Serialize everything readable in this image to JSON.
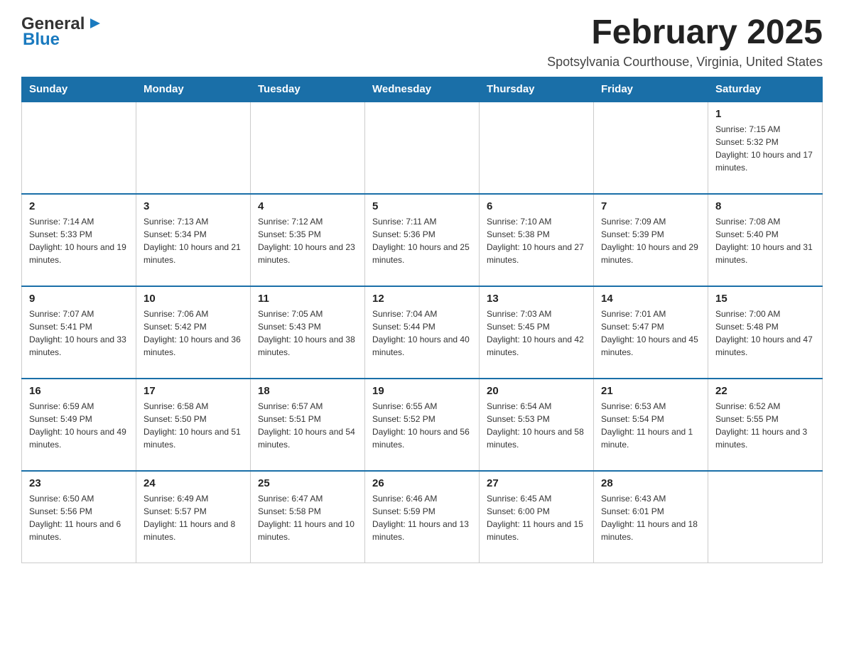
{
  "header": {
    "logo": {
      "general": "General",
      "blue": "Blue",
      "arrow_color": "#1a7abf"
    },
    "title": "February 2025",
    "location": "Spotsylvania Courthouse, Virginia, United States"
  },
  "days_of_week": [
    "Sunday",
    "Monday",
    "Tuesday",
    "Wednesday",
    "Thursday",
    "Friday",
    "Saturday"
  ],
  "weeks": [
    {
      "days": [
        {
          "number": "",
          "info": ""
        },
        {
          "number": "",
          "info": ""
        },
        {
          "number": "",
          "info": ""
        },
        {
          "number": "",
          "info": ""
        },
        {
          "number": "",
          "info": ""
        },
        {
          "number": "",
          "info": ""
        },
        {
          "number": "1",
          "info": "Sunrise: 7:15 AM\nSunset: 5:32 PM\nDaylight: 10 hours and 17 minutes."
        }
      ]
    },
    {
      "days": [
        {
          "number": "2",
          "info": "Sunrise: 7:14 AM\nSunset: 5:33 PM\nDaylight: 10 hours and 19 minutes."
        },
        {
          "number": "3",
          "info": "Sunrise: 7:13 AM\nSunset: 5:34 PM\nDaylight: 10 hours and 21 minutes."
        },
        {
          "number": "4",
          "info": "Sunrise: 7:12 AM\nSunset: 5:35 PM\nDaylight: 10 hours and 23 minutes."
        },
        {
          "number": "5",
          "info": "Sunrise: 7:11 AM\nSunset: 5:36 PM\nDaylight: 10 hours and 25 minutes."
        },
        {
          "number": "6",
          "info": "Sunrise: 7:10 AM\nSunset: 5:38 PM\nDaylight: 10 hours and 27 minutes."
        },
        {
          "number": "7",
          "info": "Sunrise: 7:09 AM\nSunset: 5:39 PM\nDaylight: 10 hours and 29 minutes."
        },
        {
          "number": "8",
          "info": "Sunrise: 7:08 AM\nSunset: 5:40 PM\nDaylight: 10 hours and 31 minutes."
        }
      ]
    },
    {
      "days": [
        {
          "number": "9",
          "info": "Sunrise: 7:07 AM\nSunset: 5:41 PM\nDaylight: 10 hours and 33 minutes."
        },
        {
          "number": "10",
          "info": "Sunrise: 7:06 AM\nSunset: 5:42 PM\nDaylight: 10 hours and 36 minutes."
        },
        {
          "number": "11",
          "info": "Sunrise: 7:05 AM\nSunset: 5:43 PM\nDaylight: 10 hours and 38 minutes."
        },
        {
          "number": "12",
          "info": "Sunrise: 7:04 AM\nSunset: 5:44 PM\nDaylight: 10 hours and 40 minutes."
        },
        {
          "number": "13",
          "info": "Sunrise: 7:03 AM\nSunset: 5:45 PM\nDaylight: 10 hours and 42 minutes."
        },
        {
          "number": "14",
          "info": "Sunrise: 7:01 AM\nSunset: 5:47 PM\nDaylight: 10 hours and 45 minutes."
        },
        {
          "number": "15",
          "info": "Sunrise: 7:00 AM\nSunset: 5:48 PM\nDaylight: 10 hours and 47 minutes."
        }
      ]
    },
    {
      "days": [
        {
          "number": "16",
          "info": "Sunrise: 6:59 AM\nSunset: 5:49 PM\nDaylight: 10 hours and 49 minutes."
        },
        {
          "number": "17",
          "info": "Sunrise: 6:58 AM\nSunset: 5:50 PM\nDaylight: 10 hours and 51 minutes."
        },
        {
          "number": "18",
          "info": "Sunrise: 6:57 AM\nSunset: 5:51 PM\nDaylight: 10 hours and 54 minutes."
        },
        {
          "number": "19",
          "info": "Sunrise: 6:55 AM\nSunset: 5:52 PM\nDaylight: 10 hours and 56 minutes."
        },
        {
          "number": "20",
          "info": "Sunrise: 6:54 AM\nSunset: 5:53 PM\nDaylight: 10 hours and 58 minutes."
        },
        {
          "number": "21",
          "info": "Sunrise: 6:53 AM\nSunset: 5:54 PM\nDaylight: 11 hours and 1 minute."
        },
        {
          "number": "22",
          "info": "Sunrise: 6:52 AM\nSunset: 5:55 PM\nDaylight: 11 hours and 3 minutes."
        }
      ]
    },
    {
      "days": [
        {
          "number": "23",
          "info": "Sunrise: 6:50 AM\nSunset: 5:56 PM\nDaylight: 11 hours and 6 minutes."
        },
        {
          "number": "24",
          "info": "Sunrise: 6:49 AM\nSunset: 5:57 PM\nDaylight: 11 hours and 8 minutes."
        },
        {
          "number": "25",
          "info": "Sunrise: 6:47 AM\nSunset: 5:58 PM\nDaylight: 11 hours and 10 minutes."
        },
        {
          "number": "26",
          "info": "Sunrise: 6:46 AM\nSunset: 5:59 PM\nDaylight: 11 hours and 13 minutes."
        },
        {
          "number": "27",
          "info": "Sunrise: 6:45 AM\nSunset: 6:00 PM\nDaylight: 11 hours and 15 minutes."
        },
        {
          "number": "28",
          "info": "Sunrise: 6:43 AM\nSunset: 6:01 PM\nDaylight: 11 hours and 18 minutes."
        },
        {
          "number": "",
          "info": ""
        }
      ]
    }
  ]
}
